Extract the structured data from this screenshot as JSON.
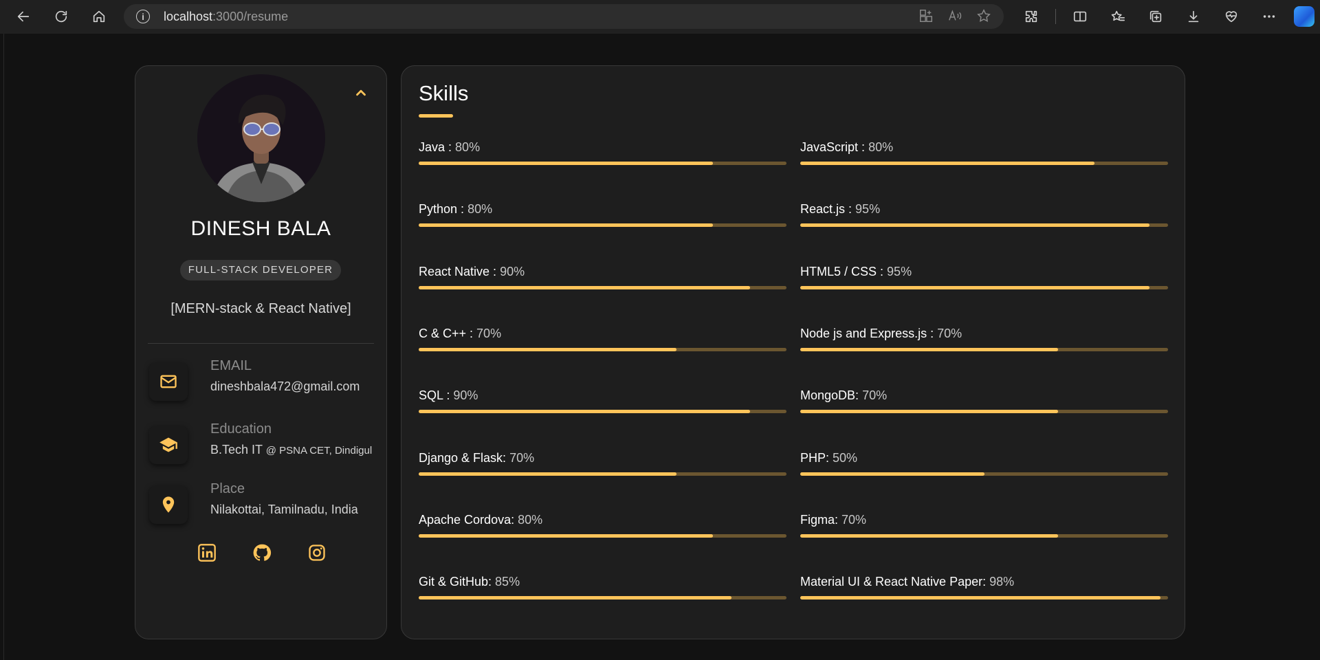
{
  "browser": {
    "url_host": "localhost",
    "url_path": ":3000/resume",
    "info_icon_text": "i"
  },
  "profile": {
    "name": "DINESH BALA",
    "role": "FULL-STACK DEVELOPER",
    "stack": "[MERN-stack & React Native]",
    "email_label": "EMAIL",
    "email_value": "dineshbala472@gmail.com",
    "education_label": "Education",
    "education_degree": "B.Tech IT",
    "education_school": "@ PSNA CET, Dindigul",
    "place_label": "Place",
    "place_value": "Nilakottai, Tamilnadu, India",
    "accent_color": "#ffc45a"
  },
  "skills": {
    "title": "Skills",
    "items": [
      {
        "name": "Java :",
        "pct_label": "80%",
        "value": 80
      },
      {
        "name": "JavaScript :",
        "pct_label": "80%",
        "value": 80
      },
      {
        "name": "Python :",
        "pct_label": "80%",
        "value": 80
      },
      {
        "name": "React.js :",
        "pct_label": "95%",
        "value": 95
      },
      {
        "name": "React Native :",
        "pct_label": "90%",
        "value": 90
      },
      {
        "name": "HTML5 / CSS :",
        "pct_label": "95%",
        "value": 95
      },
      {
        "name": "C & C++ :",
        "pct_label": "70%",
        "value": 70
      },
      {
        "name": "Node js and Express.js :",
        "pct_label": "70%",
        "value": 70
      },
      {
        "name": "SQL :",
        "pct_label": "90%",
        "value": 90
      },
      {
        "name": "MongoDB:",
        "pct_label": "70%",
        "value": 70
      },
      {
        "name": "Django & Flask:",
        "pct_label": "70%",
        "value": 70
      },
      {
        "name": "PHP:",
        "pct_label": "50%",
        "value": 50
      },
      {
        "name": "Apache Cordova:",
        "pct_label": "80%",
        "value": 80
      },
      {
        "name": "Figma:",
        "pct_label": "70%",
        "value": 70
      },
      {
        "name": "Git & GitHub:",
        "pct_label": "85%",
        "value": 85
      },
      {
        "name": "Material UI & React Native Paper:",
        "pct_label": "98%",
        "value": 98
      }
    ]
  }
}
